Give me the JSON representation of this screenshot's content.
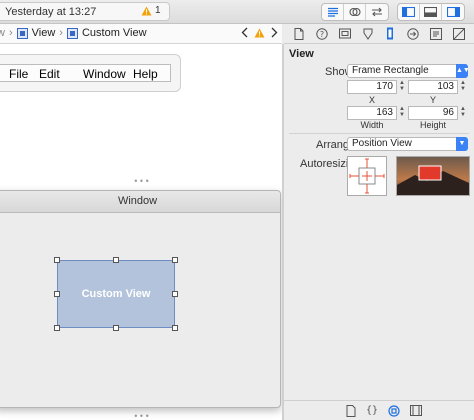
{
  "toolbar": {
    "status": "Yesterday at 13:27",
    "warning_count": "1"
  },
  "jumpbar": {
    "crumb_view": "View",
    "crumb_custom_view": "Custom View"
  },
  "menubar": {
    "items": [
      "File",
      "Edit",
      "Window",
      "Help"
    ]
  },
  "canvas": {
    "window_title": "Window",
    "custom_view_label": "Custom View"
  },
  "inspector": {
    "section_title": "View",
    "show_label": "Show",
    "show_value": "Frame Rectangle",
    "x_value": "170",
    "y_value": "103",
    "x_label": "X",
    "y_label": "Y",
    "width_value": "163",
    "height_value": "96",
    "width_label": "Width",
    "height_label": "Height",
    "arrange_label": "Arrange",
    "arrange_value": "Position View",
    "autoresizing_label": "Autoresizing"
  },
  "colors": {
    "accent": "#1e6fe0",
    "custom_view_fill": "#b4c3dc",
    "autoresize_red": "#e8513a",
    "warning": "#f0a30a"
  }
}
